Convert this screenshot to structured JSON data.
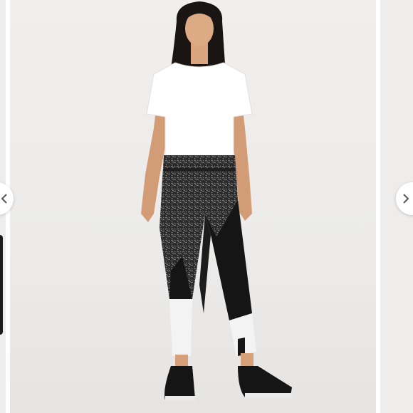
{
  "gallery": {
    "prev_label": "",
    "next_label": ""
  },
  "product_image": {
    "subject": "",
    "colors": {
      "background": "#ecebe9",
      "top": "#ffffff",
      "legging_print": "#2a2a2a",
      "legging_panel": "#151515",
      "white_panel": "#f3f3f3",
      "skin": "#d9a47e",
      "hair": "#1a1412"
    }
  },
  "icons": {
    "prev": "chevron-left-icon",
    "next": "chevron-right-icon"
  }
}
